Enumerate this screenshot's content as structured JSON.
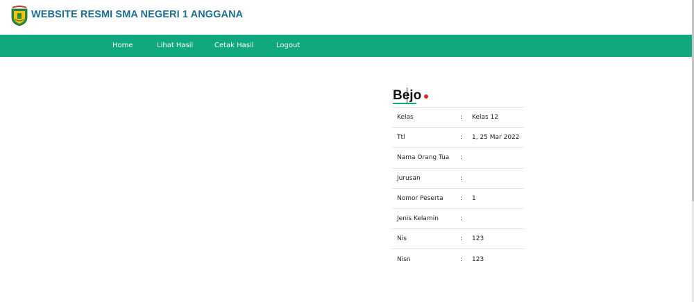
{
  "header": {
    "site_title": "WEBSITE RESMI SMA NEGERI 1 ANGGANA",
    "logo_icon": "school-emblem-icon"
  },
  "nav": {
    "items": [
      {
        "label": "Home"
      },
      {
        "label": "Lihat Hasil"
      },
      {
        "label": "Cetak Hasil"
      },
      {
        "label": "Logout"
      }
    ]
  },
  "profile": {
    "name": "Bejo",
    "fields": [
      {
        "label": "Kelas",
        "sep": ":",
        "value": "Kelas 12"
      },
      {
        "label": "Ttl",
        "sep": ":",
        "value": "1, 25 Mar 2022"
      },
      {
        "label": "Nama Orang Tua",
        "sep": ":",
        "value": ""
      },
      {
        "label": "Jurusan",
        "sep": ":",
        "value": ""
      },
      {
        "label": "Nomor Peserta",
        "sep": ":",
        "value": "1"
      },
      {
        "label": "Jenis Kelamin",
        "sep": ":",
        "value": ""
      },
      {
        "label": "Nis",
        "sep": ":",
        "value": "123"
      },
      {
        "label": "Nisn",
        "sep": ":",
        "value": "123"
      }
    ]
  },
  "colors": {
    "nav_bg": "#10a97f",
    "title": "#1b6f93",
    "accent_dot": "#e52727"
  }
}
